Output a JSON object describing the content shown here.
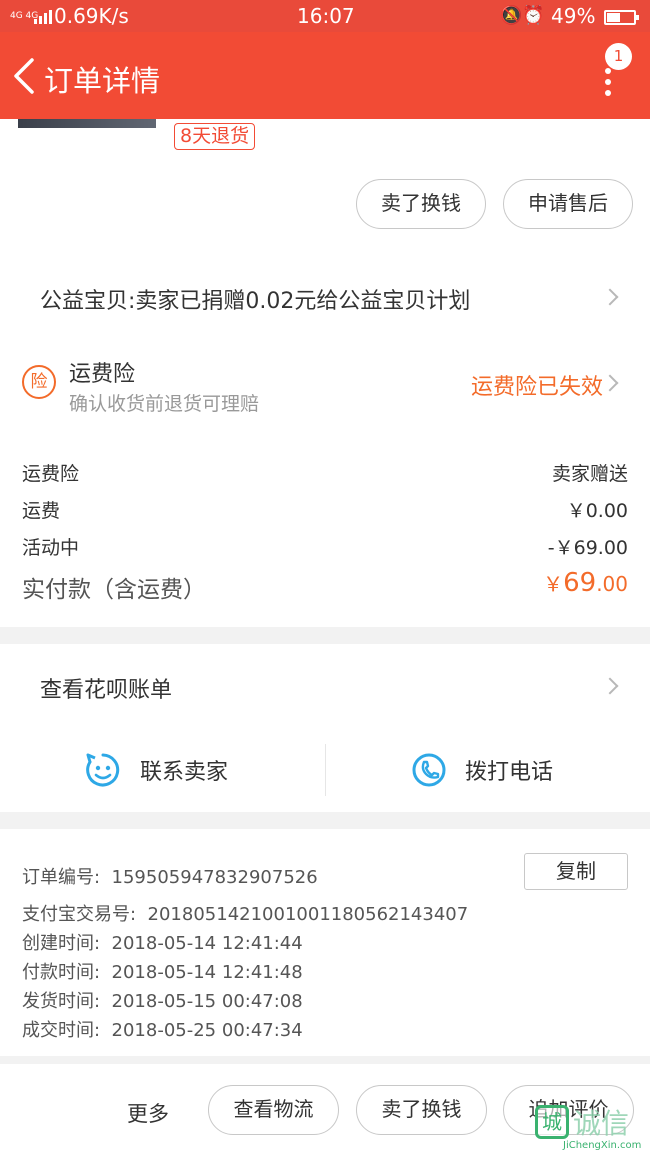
{
  "status_bar": {
    "network": "4G 4G",
    "speed": "0.69K/s",
    "time": "16:07",
    "battery": "49%"
  },
  "navbar": {
    "title": "订单详情",
    "badge": "1"
  },
  "product": {
    "refund_tag": "8天退货",
    "sell_label": "卖了换钱",
    "aftersale_label": "申请售后"
  },
  "charity": {
    "text": "公益宝贝:卖家已捐赠0.02元给公益宝贝计划"
  },
  "insurance": {
    "icon_text": "险",
    "title": "运费险",
    "subtitle": "确认收货前退货可理赔",
    "status": "运费险已失效"
  },
  "fees": [
    {
      "label": "运费险",
      "value": "卖家赠送",
      "highlight": false
    },
    {
      "label": "运费",
      "value": "￥0.00",
      "highlight": false
    },
    {
      "label": "活动中",
      "value": "-￥69.00",
      "highlight": false
    }
  ],
  "total": {
    "label": "实付款（含运费）",
    "currency": "￥",
    "integer": "69",
    "decimal": ".00"
  },
  "huabei": {
    "label": "查看花呗账单"
  },
  "contact": {
    "seller_label": "联系卖家",
    "call_label": "拨打电话"
  },
  "order_info": {
    "order_no_label": "订单编号:",
    "order_no": "1595059478329075​26",
    "copy_label": "复制",
    "rows": [
      {
        "label": "支付宝交易号:",
        "value": "2018051421001001180562143407"
      },
      {
        "label": "创建时间:",
        "value": "2018-05-14 12:41:44"
      },
      {
        "label": "付款时间:",
        "value": "2018-05-14 12:41:48"
      },
      {
        "label": "发货时间:",
        "value": "2018-05-15 00:47:08"
      },
      {
        "label": "成交时间:",
        "value": "2018-05-25 00:47:34"
      }
    ]
  },
  "bottom_bar": {
    "more": "更多",
    "logistics": "查看物流",
    "sell": "卖了换钱",
    "review": "追加评价"
  },
  "watermark": {
    "logo": "城",
    "cn": "诚信",
    "en": "JiChengXin.com"
  },
  "colors": {
    "brand_red": "#f24b35",
    "orange": "#f36b2a",
    "contact_blue": "#2ea8e6"
  }
}
